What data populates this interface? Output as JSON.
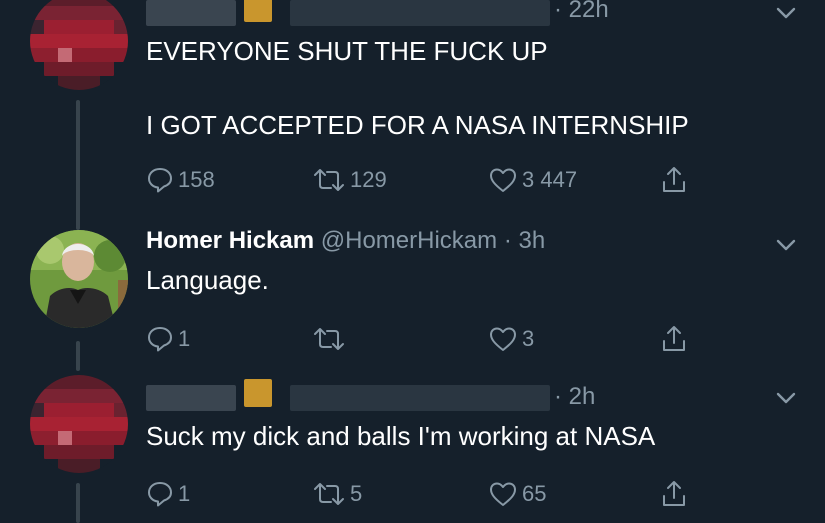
{
  "tweets": [
    {
      "name": "",
      "handle": "",
      "time": "· 22h",
      "lines": [
        "EVERYONE SHUT THE FUCK UP",
        "I GOT ACCEPTED FOR A NASA INTERNSHIP"
      ],
      "replies": "158",
      "retweets": "129",
      "likes": "3 447"
    },
    {
      "name": "Homer Hickam",
      "handle": "@HomerHickam",
      "time": "· 3h",
      "lines": [
        "Language."
      ],
      "replies": "1",
      "retweets": "",
      "likes": "3"
    },
    {
      "name": "",
      "handle": "",
      "time": "· 2h",
      "lines": [
        "Suck my dick and balls I'm working at NASA"
      ],
      "replies": "1",
      "retweets": "5",
      "likes": "65"
    }
  ],
  "icons": {
    "reply": "reply-icon",
    "retweet": "retweet-icon",
    "like": "heart-icon",
    "share": "share-icon",
    "menu": "chevron-down-icon"
  },
  "colors": {
    "background": "#15202b",
    "secondary_text": "#8899a6",
    "thread_line": "#38444d"
  }
}
